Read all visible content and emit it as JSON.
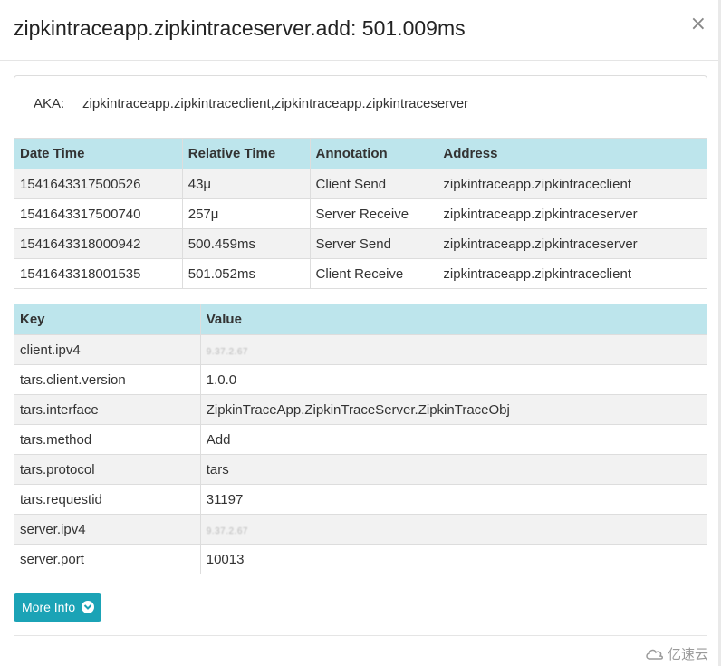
{
  "modal": {
    "title": "zipkintraceapp.zipkintraceserver.add: 501.009ms",
    "close_glyph": "×"
  },
  "aka": {
    "label": "AKA:",
    "value": "zipkintraceapp.zipkintraceclient,zipkintraceapp.zipkintraceserver"
  },
  "annotations": {
    "headers": [
      "Date Time",
      "Relative Time",
      "Annotation",
      "Address"
    ],
    "rows": [
      [
        "1541643317500526",
        "43μ",
        "Client Send",
        "zipkintraceapp.zipkintraceclient"
      ],
      [
        "1541643317500740",
        "257μ",
        "Server Receive",
        "zipkintraceapp.zipkintraceserver"
      ],
      [
        "1541643318000942",
        "500.459ms",
        "Server Send",
        "zipkintraceapp.zipkintraceserver"
      ],
      [
        "1541643318001535",
        "501.052ms",
        "Client Receive",
        "zipkintraceapp.zipkintraceclient"
      ]
    ]
  },
  "tags": {
    "headers": [
      "Key",
      "Value"
    ],
    "rows": [
      [
        "client.ipv4",
        "9.37.2.67"
      ],
      [
        "tars.client.version",
        "1.0.0"
      ],
      [
        "tars.interface",
        "ZipkinTraceApp.ZipkinTraceServer.ZipkinTraceObj"
      ],
      [
        "tars.method",
        "Add"
      ],
      [
        "tars.protocol",
        "tars"
      ],
      [
        "tars.requestid",
        "31197"
      ],
      [
        "server.ipv4",
        "9.37.2.67"
      ],
      [
        "server.port",
        "10013"
      ]
    ]
  },
  "footer": {
    "more_info_label": "More Info",
    "more_info_icon": "chevron-down-circle-icon",
    "watermark_text": "亿速云"
  },
  "colors": {
    "header_bg": "#bde5ec",
    "button_bg": "#1ba3b6",
    "odd_row_bg": "#f2f2f2"
  }
}
